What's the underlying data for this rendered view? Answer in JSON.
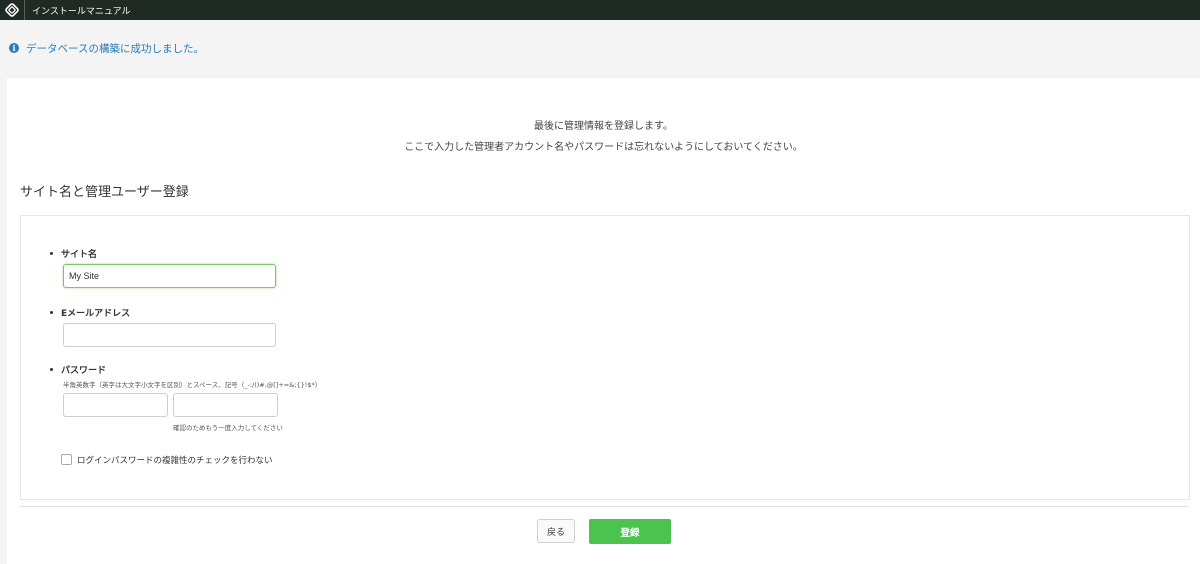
{
  "topbar": {
    "title": "インストールマニュアル",
    "logo_icon": "logo-mark-icon"
  },
  "flash": {
    "icon": "info-icon",
    "message": "データベースの構築に成功しました。"
  },
  "intro": {
    "line1": "最後に管理情報を登録します。",
    "line2": "ここで入力した管理者アカウント名やパスワードは忘れないようにしておいてください。"
  },
  "section": {
    "heading": "サイト名と管理ユーザー登録"
  },
  "form": {
    "site_name": {
      "label": "サイト名",
      "value": "My Site"
    },
    "email": {
      "label": "Eメールアドレス",
      "value": ""
    },
    "password": {
      "label": "パスワード",
      "hint": "半角英数字（英字は大文字小文字を区別）とスペース、記号（_-:/()#,@[]+=&;{}!$*）",
      "confirm_hint": "確認のためもう一度入力してください",
      "value": "",
      "confirm_value": ""
    },
    "skip_complexity_check": {
      "label": "ログインパスワードの複雑性のチェックを行わない",
      "checked": false
    }
  },
  "buttons": {
    "back": "戻る",
    "submit": "登録"
  },
  "colors": {
    "topbar": "#202a24",
    "info": "#2a7bb7",
    "submit": "#4cc24f",
    "focus": "#7bc66c"
  }
}
